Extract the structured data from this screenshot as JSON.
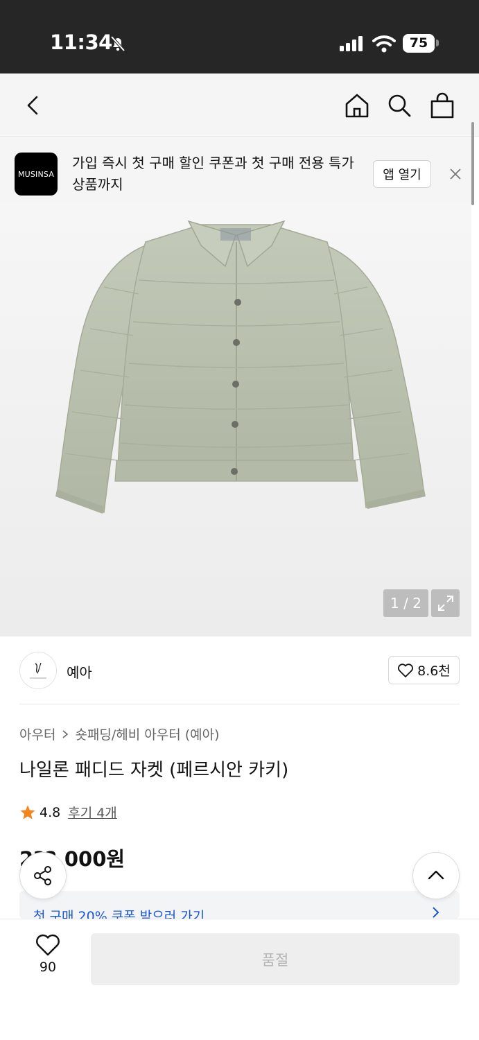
{
  "status_bar": {
    "time": "11:34",
    "battery": "75"
  },
  "banner": {
    "logo_text": "MUSINSA",
    "message": "가입 즉시 첫 구매 할인 쿠폰과 첫 구매 전용 특가 상품까지",
    "open_label": "앱 열기"
  },
  "gallery": {
    "counter": "1 / 2"
  },
  "brand": {
    "name": "예아",
    "likes": "8.6천"
  },
  "product": {
    "breadcrumb": [
      "아우터",
      "숏패딩/헤비 아우터 (예아)"
    ],
    "title": "나일론 패디드 자켓 (페르시안 카키)",
    "rating": "4.8",
    "review_link": "후기 4개",
    "price": "2??,000원"
  },
  "coupon": {
    "text": "첫 구매 20% 쿠폰 받으러 가기"
  },
  "bottom_bar": {
    "wish_count": "90",
    "cta_label": "품절"
  },
  "colors": {
    "accent_blue": "#1b57d6",
    "star": "#f5841f",
    "jacket": "#b9c0ae"
  }
}
